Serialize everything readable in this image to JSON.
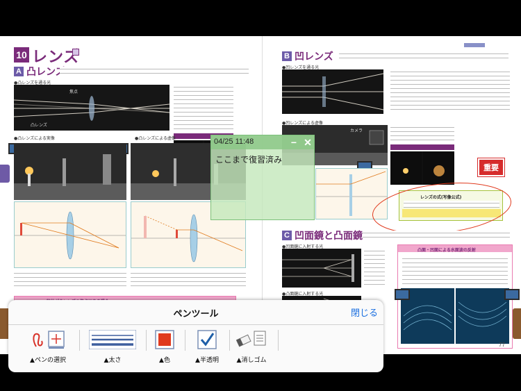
{
  "book": {
    "left_page": {
      "chapter_number": "10",
      "chapter_title": "レンズ",
      "section_a_badge": "A",
      "section_a_title": "凸レンズ",
      "caption_1": "●凸レンズを通る光",
      "caption_2": "●凸レンズによる実像",
      "caption_3": "●凸レンズによる虚像",
      "focus_label": "焦点",
      "label_convex": "凸レンズ",
      "point_title": "物体が凸レンズの焦点にある場合"
    },
    "right_page": {
      "section_b_badge": "B",
      "section_b_title": "凹レンズ",
      "caption_1": "●凹レンズを通る光",
      "caption_2": "●凹レンズによる虚像",
      "camera_label": "カメラ",
      "section_c_badge": "C",
      "section_c_title": "凹面鏡と凸面鏡",
      "caption_3": "●凹面鏡に入射する光",
      "caption_4": "●凸面鏡に入射する光",
      "important_badge": "重要",
      "formula_title": "レンズの式(写像公式)",
      "point_title": "凸面・凹面による水面波の反射",
      "page_number": "77"
    }
  },
  "note": {
    "timestamp": "04/25 11:48",
    "text": "ここまで復習済み",
    "minimize_label": "−",
    "close_label": "✕"
  },
  "pen_panel": {
    "title": "ペンツール",
    "close_label": "閉じる",
    "tools": [
      {
        "label": "▲ペンの選択"
      },
      {
        "label": "▲太さ"
      },
      {
        "label": "▲色"
      },
      {
        "label": "▲半透明"
      },
      {
        "label": "▲消しゴム"
      }
    ]
  },
  "colors": {
    "accent_blue": "#1a6fe0",
    "chapter_purple": "#7a2b7a",
    "pen_red": "#e03a1e",
    "note_green": "#c4e8bc"
  }
}
